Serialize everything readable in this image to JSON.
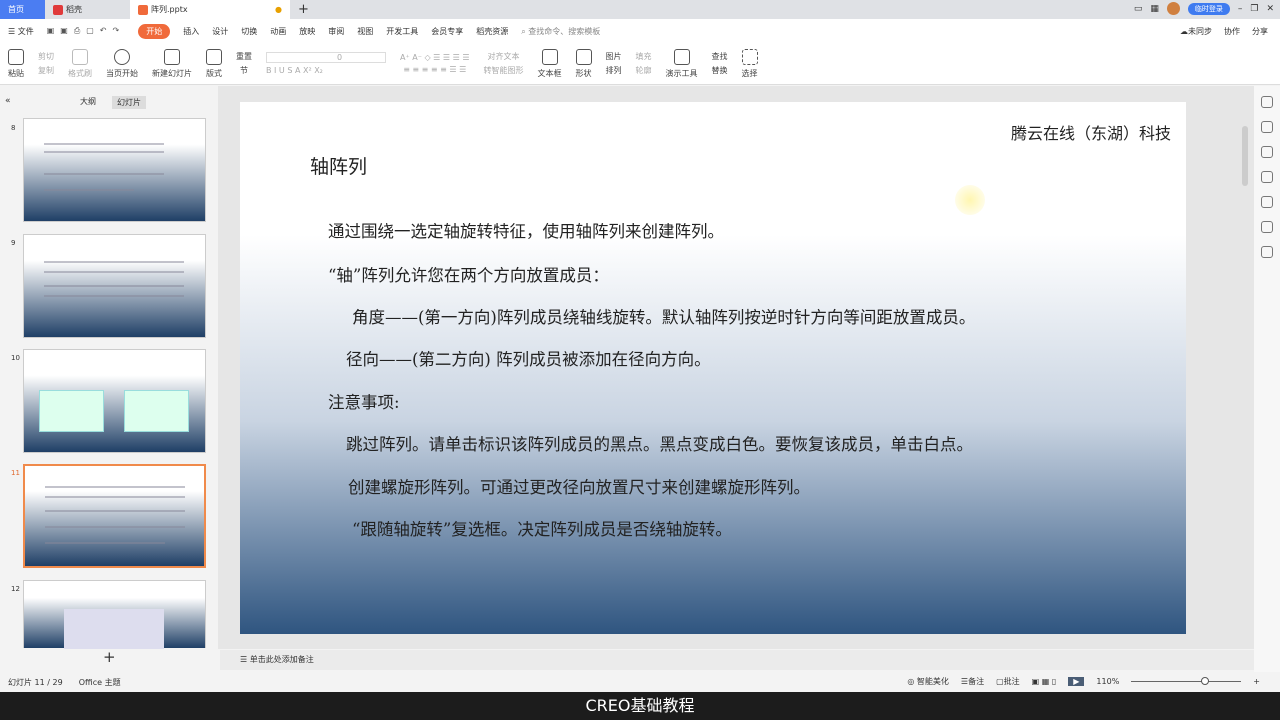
{
  "tabs": {
    "home": "首页",
    "doc1": "稻壳",
    "active": "阵列.pptx",
    "login": "临时登录"
  },
  "menu": {
    "file": "文件",
    "items": [
      "开始",
      "插入",
      "设计",
      "切换",
      "动画",
      "放映",
      "审阅",
      "视图",
      "开发工具",
      "会员专享",
      "稻壳资源"
    ],
    "search": "查找命令、搜索模板",
    "sync": "未同步",
    "collab": "协作",
    "share": "分享"
  },
  "ribbon": {
    "paste": "粘贴",
    "cut": "剪切",
    "copy": "复制",
    "format_painter": "格式刷",
    "play_from": "当页开始",
    "new_slide": "新建幻灯片",
    "layout": "版式",
    "section": "节",
    "reset": "重置",
    "font_size": "0",
    "align_text": "对齐文本",
    "smart_art": "转智能图形",
    "textbox": "文本框",
    "shape": "形状",
    "picture": "图片",
    "fill": "填充",
    "arrange": "排列",
    "outline": "轮廓",
    "presenter_tools": "演示工具",
    "find": "查找",
    "replace": "替换",
    "select": "选择"
  },
  "left_panel": {
    "tab_outline": "大纲",
    "tab_slides": "幻灯片",
    "slide_numbers": [
      "8",
      "9",
      "10",
      "11",
      "12"
    ],
    "selected": "11",
    "add": "+"
  },
  "slide": {
    "company": "腾云在线（东湖）科技",
    "title": "轴阵列",
    "lines": [
      "通过围绕一选定轴旋转特征，使用轴阵列来创建阵列。",
      "“轴”阵列允许您在两个方向放置成员：",
      "角度——(第一方向)阵列成员绕轴线旋转。默认轴阵列按逆时针方向等间距放置成员。",
      "径向——(第二方向) 阵列成员被添加在径向方向。",
      "注意事项:",
      "跳过阵列。请单击标识该阵列成员的黑点。黑点变成白色。要恢复该成员，单击白点。",
      "创建螺旋形阵列。可通过更改径向放置尺寸来创建螺旋形阵列。",
      "“跟随轴旋转”复选框。决定阵列成员是否绕轴旋转。"
    ]
  },
  "notes": {
    "placeholder": "单击此处添加备注"
  },
  "status": {
    "slide_count": "幻灯片 11 / 29",
    "theme": "Office 主题",
    "beautify": "智能美化",
    "notes": "备注",
    "comment": "批注",
    "zoom": "110%"
  },
  "caption": "CREO基础教程"
}
